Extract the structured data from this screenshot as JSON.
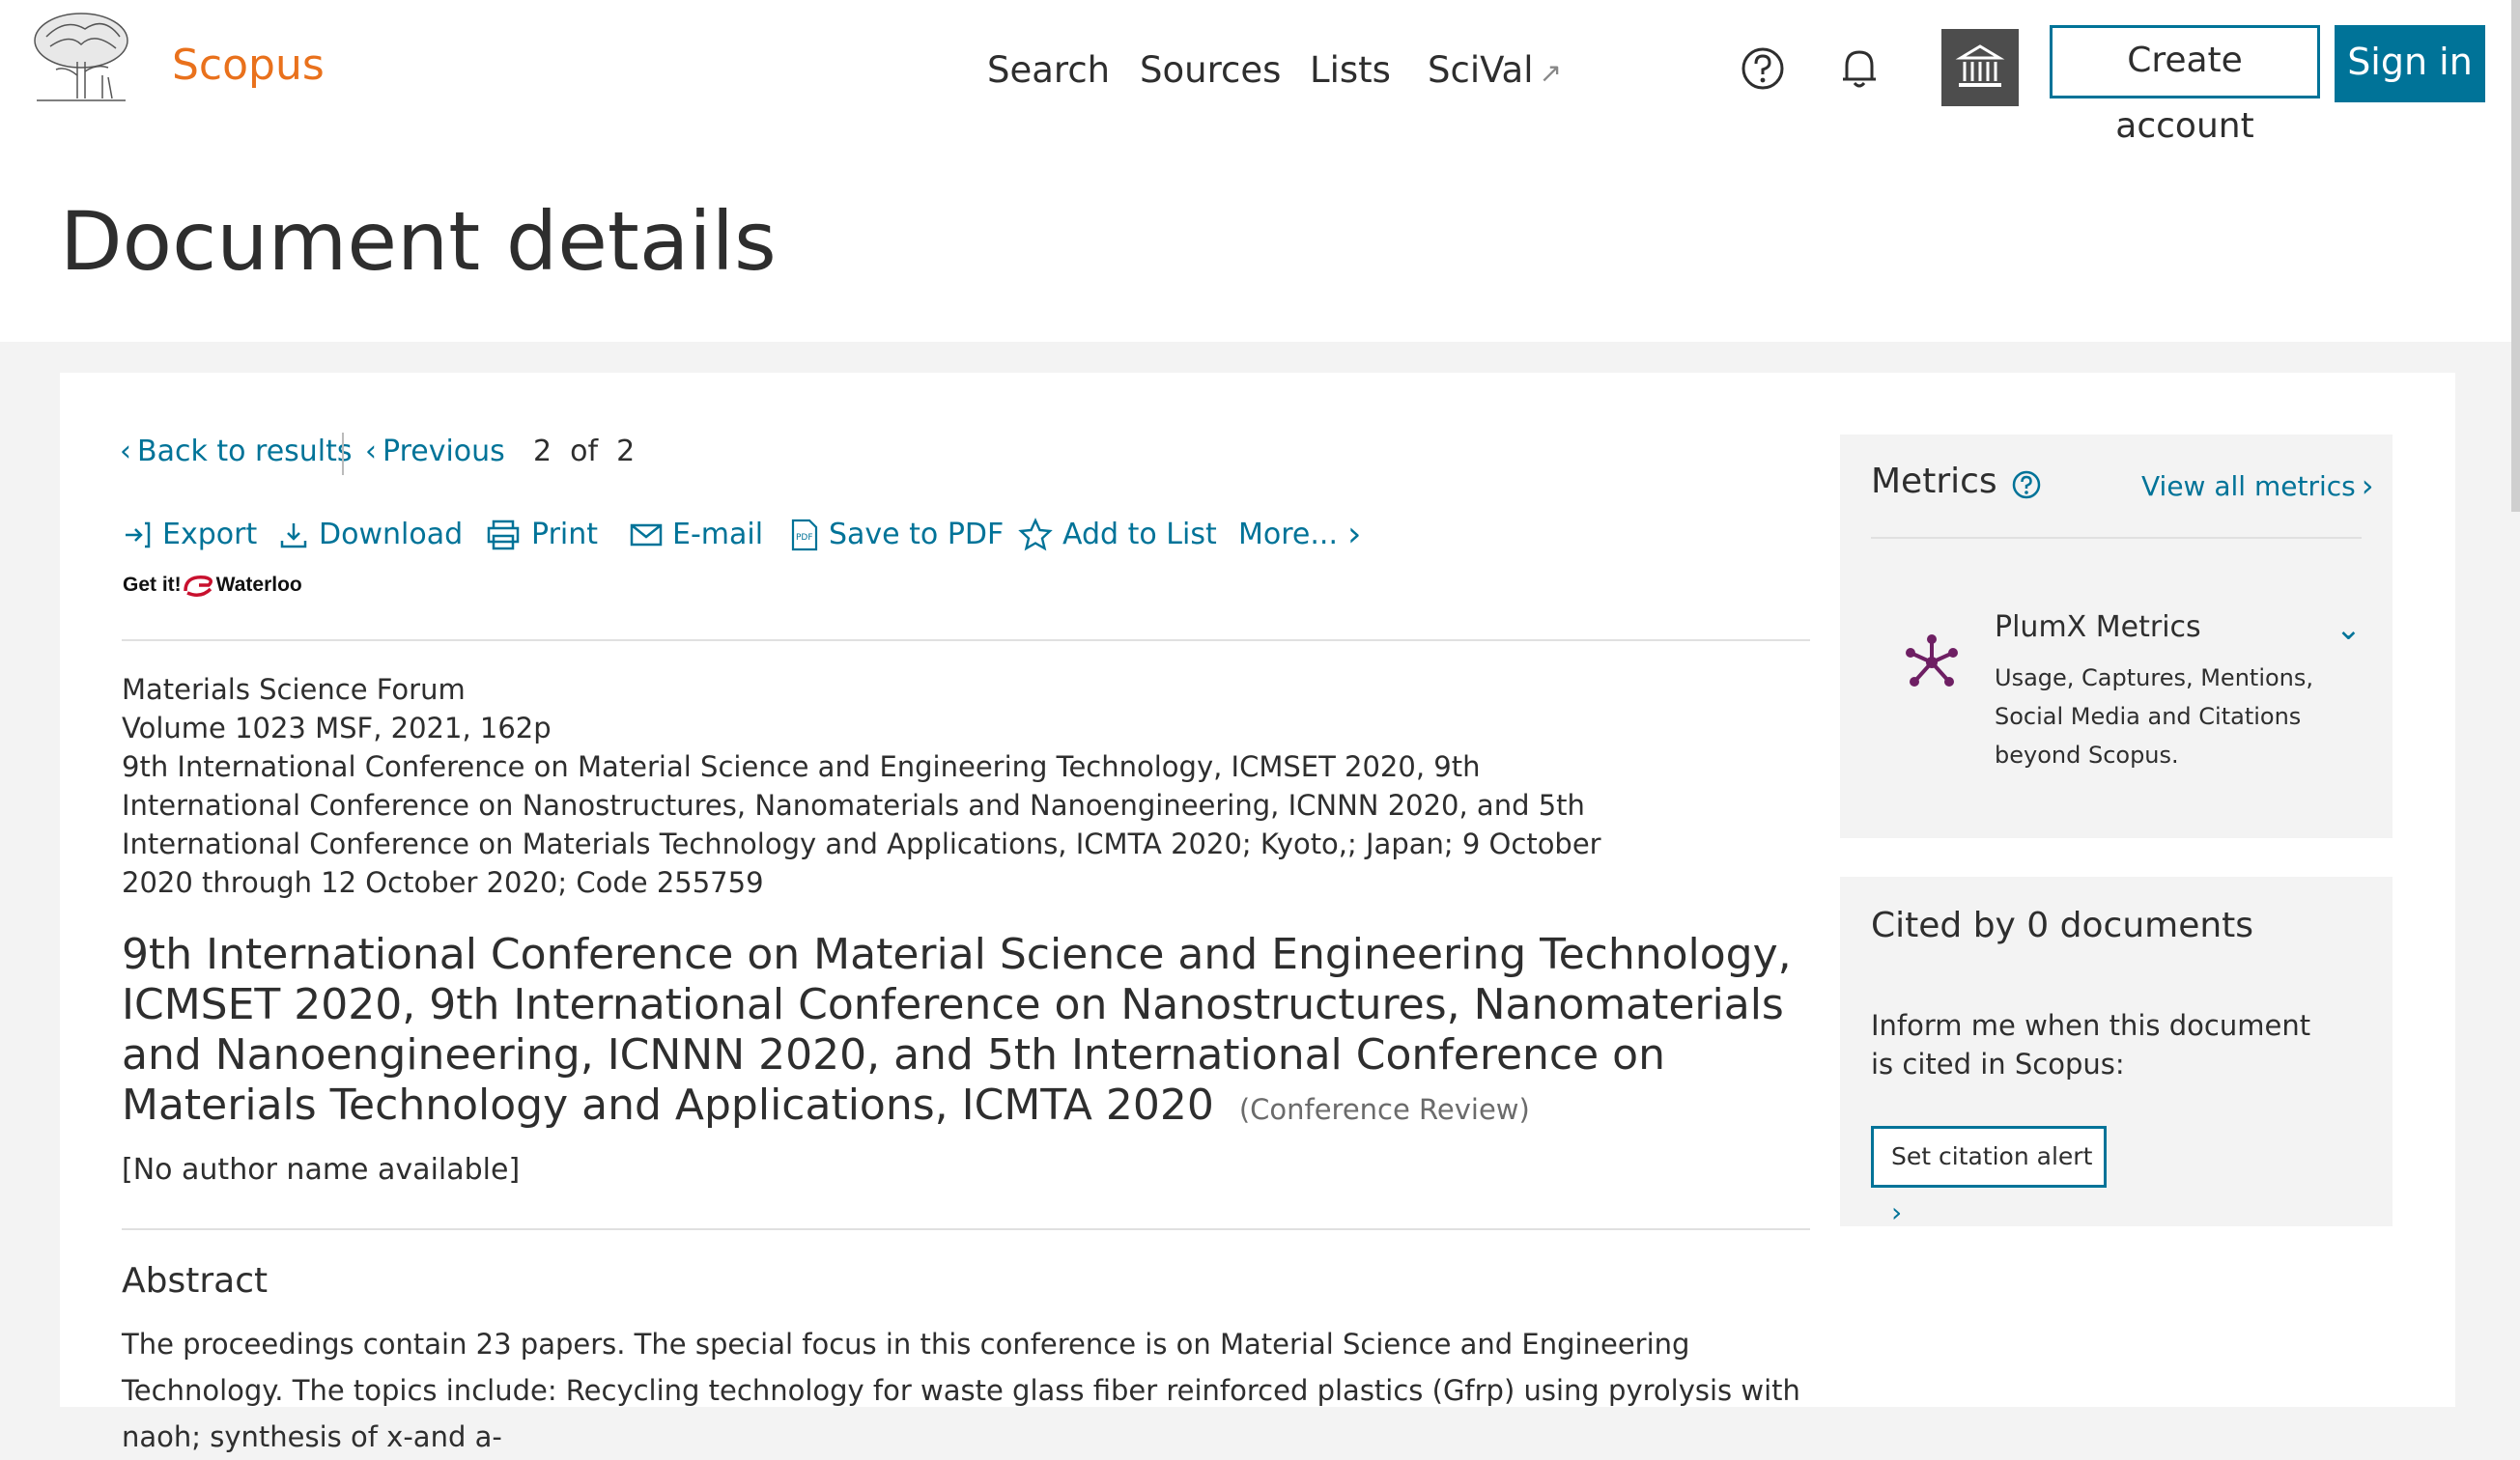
{
  "header": {
    "brand": "Scopus",
    "nav": [
      {
        "label": "Search"
      },
      {
        "label": "Sources"
      },
      {
        "label": "Lists"
      },
      {
        "label": "SciVal",
        "ext": "↗"
      }
    ],
    "create_account": "Create account",
    "sign_in": "Sign in",
    "icons": [
      "help-icon",
      "bell-icon",
      "institution-icon"
    ]
  },
  "page_title": "Document details",
  "pager": {
    "back": "Back to results",
    "previous": "Previous",
    "current": "2",
    "of": "of",
    "total": "2"
  },
  "toolbar": [
    {
      "label": "Export",
      "icon": "export-icon"
    },
    {
      "label": "Download",
      "icon": "download-icon"
    },
    {
      "label": "Print",
      "icon": "print-icon"
    },
    {
      "label": "E-mail",
      "icon": "email-icon"
    },
    {
      "label": "Save to PDF",
      "icon": "pdf-icon"
    },
    {
      "label": "Add to List",
      "icon": "star-icon"
    },
    {
      "label": "More...",
      "icon": "chevron-right-icon"
    }
  ],
  "getit": {
    "prefix": "Get it!",
    "name": "Waterloo"
  },
  "source": {
    "journal": "Materials Science Forum",
    "volume": "Volume 1023 MSF, 2021, 162p",
    "conference_lines": [
      "9th International Conference on Material Science and Engineering Technology, ICMSET 2020, 9th",
      "International Conference on Nanostructures, Nanomaterials and Nanoengineering, ICNNN 2020, and 5th",
      "International Conference on Materials Technology and Applications, ICMTA 2020; Kyoto,; Japan; 9 October",
      "2020 through 12 October 2020; Code 255759"
    ]
  },
  "document": {
    "title": "9th International Conference on Material Science and Engineering Technology, ICMSET 2020, 9th International Conference on Nanostructures, Nanomaterials and Nanoengineering, ICNNN 2020, and 5th International Conference on Materials Technology and Applications, ICMTA 2020",
    "type": "(Conference Review)",
    "authors": "[No author name available]"
  },
  "abstract": {
    "heading": "Abstract",
    "text": "The proceedings contain 23 papers. The special focus in this conference is on Material Science and Engineering Technology. The topics include: Recycling technology for waste glass fiber reinforced plastics (Gfrp) using pyrolysis with naoh; synthesis of x-and a-"
  },
  "metrics": {
    "title": "Metrics",
    "view_all": "View all metrics",
    "plumx_title": "PlumX Metrics",
    "plumx_desc": "Usage, Captures, Mentions, Social Media and Citations beyond Scopus."
  },
  "cited": {
    "title": "Cited by 0 documents",
    "text": "Inform me when this document is cited in Scopus:",
    "button": "Set citation alert"
  },
  "colors": {
    "accent": "#007398",
    "brand": "#e9711c",
    "plumx": "#6e1f63"
  }
}
